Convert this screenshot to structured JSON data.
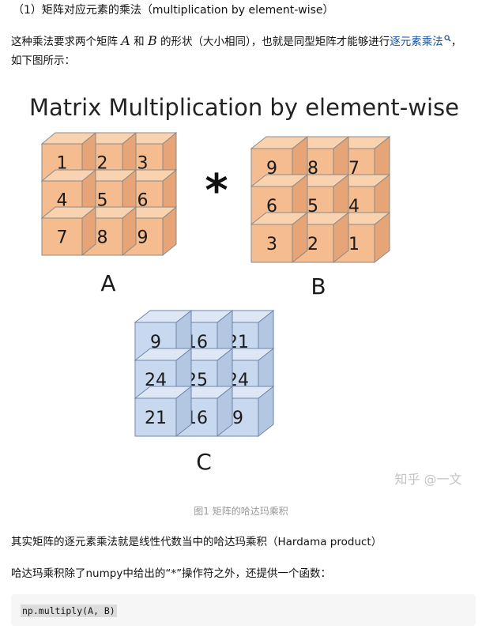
{
  "heading": "（1）矩阵对应元素的乘法（multiplication by element-wise）",
  "para1": {
    "t1": "这种乘法要求两个矩阵 ",
    "a": "A",
    "t2": " 和 ",
    "b": "B",
    "t3": " 的形状（大小相同），也就是同型矩阵才能够进行",
    "link": "逐元素乘法",
    "t4": "，",
    "line2": "如下图所示："
  },
  "figure": {
    "title": "Matrix Multiplication by element-wise",
    "operator": "*",
    "matrices": [
      {
        "label": "A",
        "values": [
          "1",
          "2",
          "3",
          "4",
          "5",
          "6",
          "7",
          "8",
          "9"
        ],
        "face": "#f5bc8f",
        "top": "#f9d2b0",
        "side": "#e6a477",
        "stroke": "#8a8a8a"
      },
      {
        "label": "B",
        "values": [
          "9",
          "8",
          "7",
          "6",
          "5",
          "4",
          "3",
          "2",
          "1"
        ],
        "face": "#f5bc8f",
        "top": "#f9d2b0",
        "side": "#e6a477",
        "stroke": "#8a8a8a"
      },
      {
        "label": "C",
        "values": [
          "9",
          "16",
          "21",
          "24",
          "25",
          "24",
          "21",
          "16",
          "9"
        ],
        "face": "#c8d8ee",
        "top": "#dde7f5",
        "side": "#b3c7e3",
        "stroke": "#6f86aa"
      }
    ],
    "watermark": "知乎 @一文"
  },
  "caption": "图1 矩阵的哈达玛乘积",
  "para2": "其实矩阵的逐元素乘法就是线性代数当中的哈达玛乘积（Hardama product）",
  "para3": "哈达玛乘积除了numpy中给出的“*”操作符之外，还提供一个函数：",
  "code": "np.multiply(A, B)",
  "icons": {
    "link_search": "search-icon"
  }
}
